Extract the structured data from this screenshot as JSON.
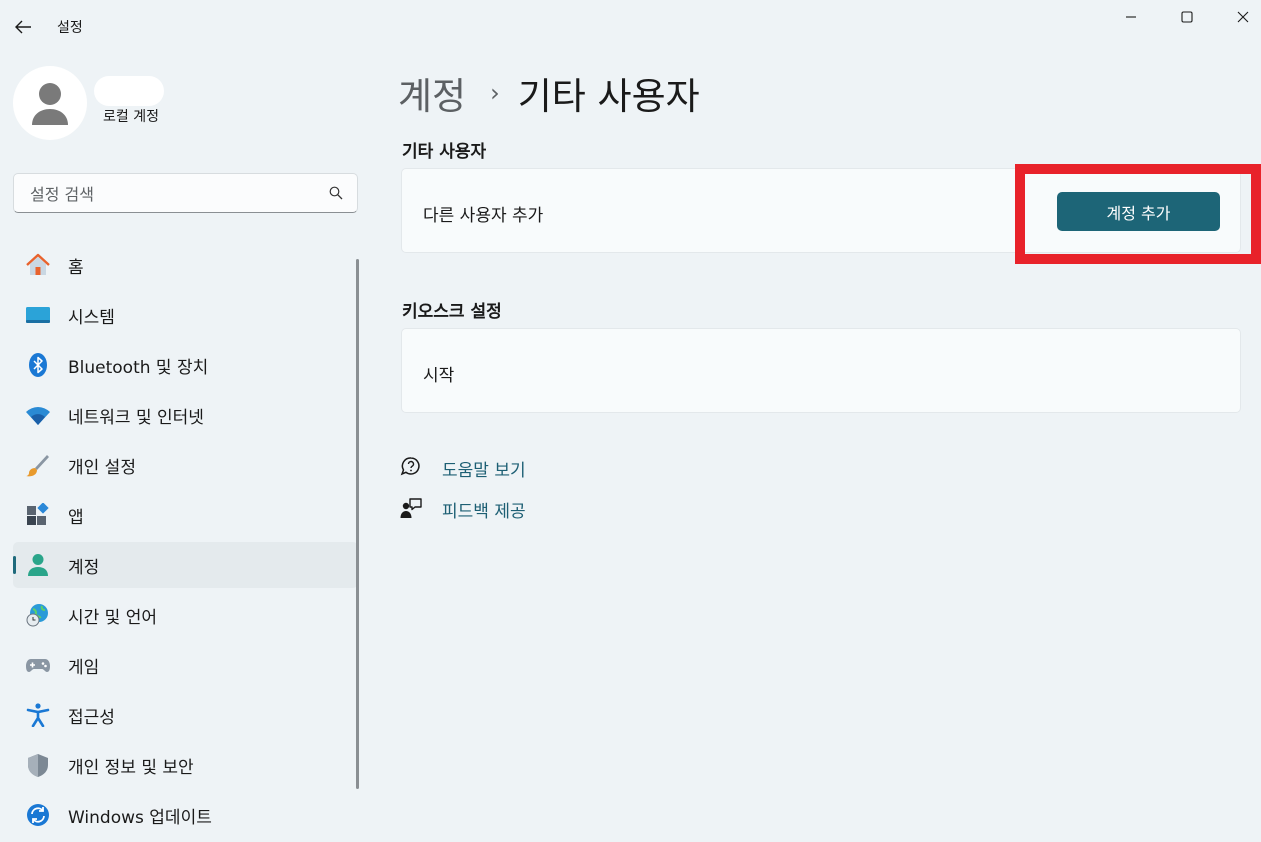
{
  "window": {
    "title": "설정",
    "controls": [
      "minimize",
      "maximize",
      "close"
    ]
  },
  "profile": {
    "role": "로컬 계정"
  },
  "search": {
    "placeholder": "설정 검색"
  },
  "sidebar": {
    "items": [
      {
        "label": "홈",
        "icon": "home-icon"
      },
      {
        "label": "시스템",
        "icon": "system-icon"
      },
      {
        "label": "Bluetooth 및 장치",
        "icon": "bluetooth-icon"
      },
      {
        "label": "네트워크 및 인터넷",
        "icon": "wifi-icon"
      },
      {
        "label": "개인 설정",
        "icon": "brush-icon"
      },
      {
        "label": "앱",
        "icon": "apps-icon"
      },
      {
        "label": "계정",
        "icon": "account-icon",
        "selected": true
      },
      {
        "label": "시간 및 언어",
        "icon": "globe-clock-icon"
      },
      {
        "label": "게임",
        "icon": "gamepad-icon"
      },
      {
        "label": "접근성",
        "icon": "accessibility-icon"
      },
      {
        "label": "개인 정보 및 보안",
        "icon": "shield-icon"
      },
      {
        "label": "Windows 업데이트",
        "icon": "update-icon"
      }
    ]
  },
  "main": {
    "breadcrumb": {
      "parent": "계정",
      "separator": "›",
      "current": "기타 사용자"
    },
    "other_users": {
      "title": "기타 사용자",
      "row_label": "다른 사용자 추가",
      "button_label": "계정 추가"
    },
    "kiosk": {
      "title": "키오스크 설정",
      "row_label": "시작"
    },
    "links": {
      "help": "도움말 보기",
      "feedback": "피드백 제공"
    }
  },
  "colors": {
    "accent": "#1d6577",
    "highlight": "#e8222a",
    "link": "#1d5f74",
    "background": "#eef3f6"
  }
}
